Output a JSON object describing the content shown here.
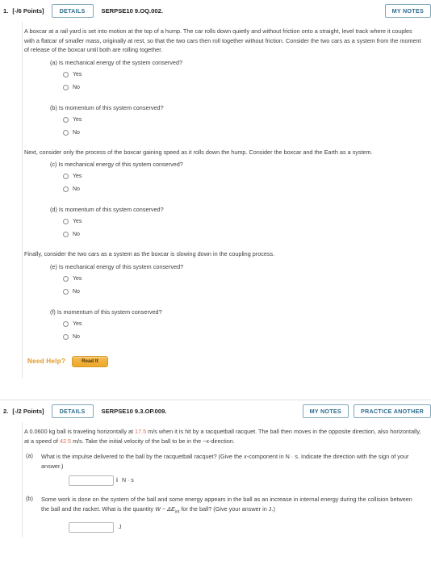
{
  "problems": [
    {
      "number": "1.",
      "points": "[-/6 Points]",
      "details_label": "DETAILS",
      "code": "SERPSE10 9.OQ.002.",
      "my_notes_label": "MY NOTES",
      "intro": "A boxcar at a rail yard is set into motion at the top of a hump. The car rolls down quietly and without friction onto a straight, level track where it couples with a flatcar of smaller mass, originally at rest, so that the two cars then roll together without friction. Consider the two cars as a system from the moment of release of the boxcar until both are rolling together.",
      "mid_text": "Next, consider only the process of the boxcar gaining speed as it rolls down the hump. Consider the boxcar and the Earth as a system.",
      "final_text": "Finally, consider the two cars as a system as the boxcar is slowing down in the coupling process.",
      "questions": [
        {
          "label": "(a) Is mechanical energy of the system conserved?",
          "options": [
            "Yes",
            "No"
          ]
        },
        {
          "label": "(b) Is momentum of this system conserved?",
          "options": [
            "Yes",
            "No"
          ]
        },
        {
          "label": "(c) Is mechanical energy of this system conserved?",
          "options": [
            "Yes",
            "No"
          ]
        },
        {
          "label": "(d) Is momentum of this system conserved?",
          "options": [
            "Yes",
            "No"
          ]
        },
        {
          "label": "(e) Is mechanical energy of this system conserved?",
          "options": [
            "Yes",
            "No"
          ]
        },
        {
          "label": "(f) Is momentum of this system conserved?",
          "options": [
            "Yes",
            "No"
          ]
        }
      ],
      "need_help_label": "Need Help?",
      "read_it_label": "Read It"
    },
    {
      "number": "2.",
      "points": "[-/2 Points]",
      "details_label": "DETAILS",
      "code": "SERPSE10 9.3.OP.009.",
      "my_notes_label": "MY NOTES",
      "practice_label": "PRACTICE ANOTHER",
      "intro_pre": "A 0.0600 kg ball is traveling horizontally at ",
      "intro_v1": "17.5",
      "intro_mid": " m/s when it is hit by a racquetball racquet. The ball then moves in the opposite direction, also horizontally, at a speed of ",
      "intro_v2": "42.5",
      "intro_post": " m/s. Take the initial velocity of the ball to be in the −x-direction.",
      "parts": [
        {
          "letter": "(a)",
          "text_pre": "What is the impulse delivered to the ball by the racquetball racquet? (Give the ",
          "text_var": "x",
          "text_post": "-component in N · s. Indicate the direction with the sign of your answer.)",
          "answer_value": "",
          "unit": "N · s"
        },
        {
          "letter": "(b)",
          "text_pre": "Some work is done on the system of the ball and some energy appears in the ball as an increase in internal energy during the collision between the ball and the racket. What is the quantity ",
          "text_var": "W − ΔE",
          "text_sub": "int",
          "text_post": " for the ball? (Give your answer in J.)",
          "answer_value": "",
          "unit": "J"
        }
      ]
    }
  ],
  "colors": {
    "accent_button": "#2b6c8f",
    "button_border": "#7fa8bd",
    "highlight_value": "#e06a5a",
    "need_help": "#e09a2a",
    "read_it_bg": "#eda828"
  }
}
